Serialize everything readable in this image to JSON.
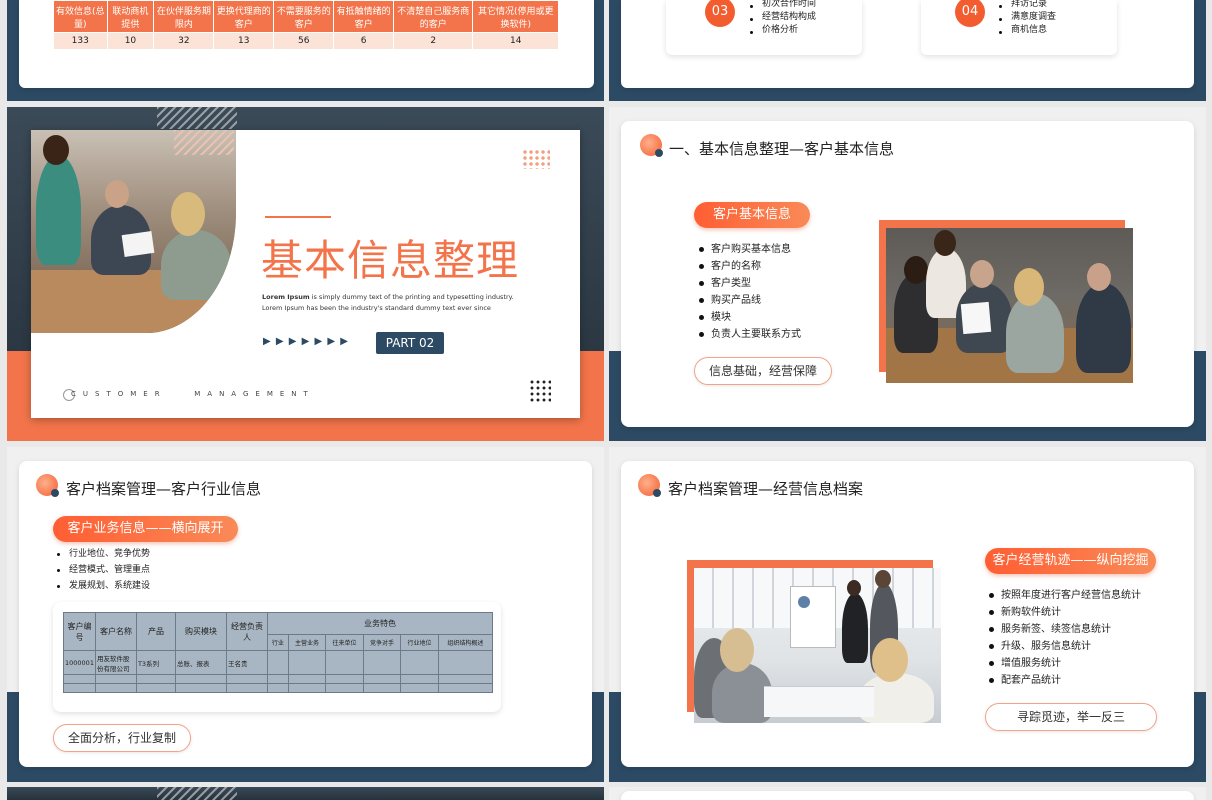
{
  "top_left": {
    "headers": [
      "有效信息(总量)",
      "联动商机提供",
      "在伙伴服务期限内",
      "更换代理商的客户",
      "不需要服务的客户",
      "有抵触情绪的客户",
      "不清楚自己服务商的客户",
      "其它情况(停用或更换软件)"
    ],
    "values": [
      "133",
      "10",
      "32",
      "13",
      "56",
      "6",
      "2",
      "14"
    ]
  },
  "top_right": {
    "item3": {
      "num": "03",
      "bullets": [
        "初次合作时间",
        "经营结构构成",
        "价格分析"
      ]
    },
    "item4": {
      "num": "04",
      "bullets": [
        "拜访记录",
        "满意度调查",
        "商机信息"
      ]
    }
  },
  "title_slide": {
    "title": "基本信息整理",
    "lorem_bold": "Lorem Ipsum",
    "lorem_line1": " is simply dummy text of the printing and typesetting industry.",
    "lorem_line2": "Lorem Ipsum has been the industry's standard dummy text ever since",
    "part_label": "PART  02",
    "arrows": "▶ ▶ ▶ ▶ ▶ ▶ ▶",
    "footer": "CUSTOMER   MANAGEMENT"
  },
  "basic_info": {
    "heading": "一、基本信息整理—客户基本信息",
    "pill": "客户基本信息",
    "bullets": [
      " 客户购买基本信息",
      "客户的名称",
      "客户类型",
      "购买产品线",
      "模块",
      "负责人主要联系方式"
    ],
    "outline": "信息基础，经营保障"
  },
  "industry": {
    "heading": "客户档案管理—客户行业信息",
    "pill": "客户业务信息——横向展开",
    "bullets": [
      "行业地位、竞争优势",
      "经营模式、管理重点",
      "发展规划、系统建设"
    ],
    "table": {
      "h_id": "客户编号",
      "h_name": "客户名称",
      "h_product": "产品",
      "h_module": "购买模块",
      "h_owner": "经营负责人",
      "h_group": "业务特色",
      "sub": [
        "行业",
        "主营业务",
        "往来单位",
        "竞争对手",
        "行业地位",
        "组织结构概述"
      ],
      "row": {
        "id": "1000001",
        "name": "用友软件股份有限公司",
        "product": "T3系列",
        "module": "总账、报表",
        "owner": "王名贵"
      }
    },
    "outline": "全面分析，行业复制"
  },
  "operations": {
    "heading": "客户档案管理—经营信息档案",
    "pill": "客户经营轨迹——纵向挖掘",
    "bullets": [
      " 按照年度进行客户经营信息统计",
      "新购软件统计",
      "服务新签、续签信息统计",
      "升级、服务信息统计",
      "增值服务统计",
      "配套产品统计"
    ],
    "outline": "寻踪觅迹，举一反三"
  },
  "colors": {
    "accent": "#f3744a",
    "navy": "#2c4a63"
  }
}
